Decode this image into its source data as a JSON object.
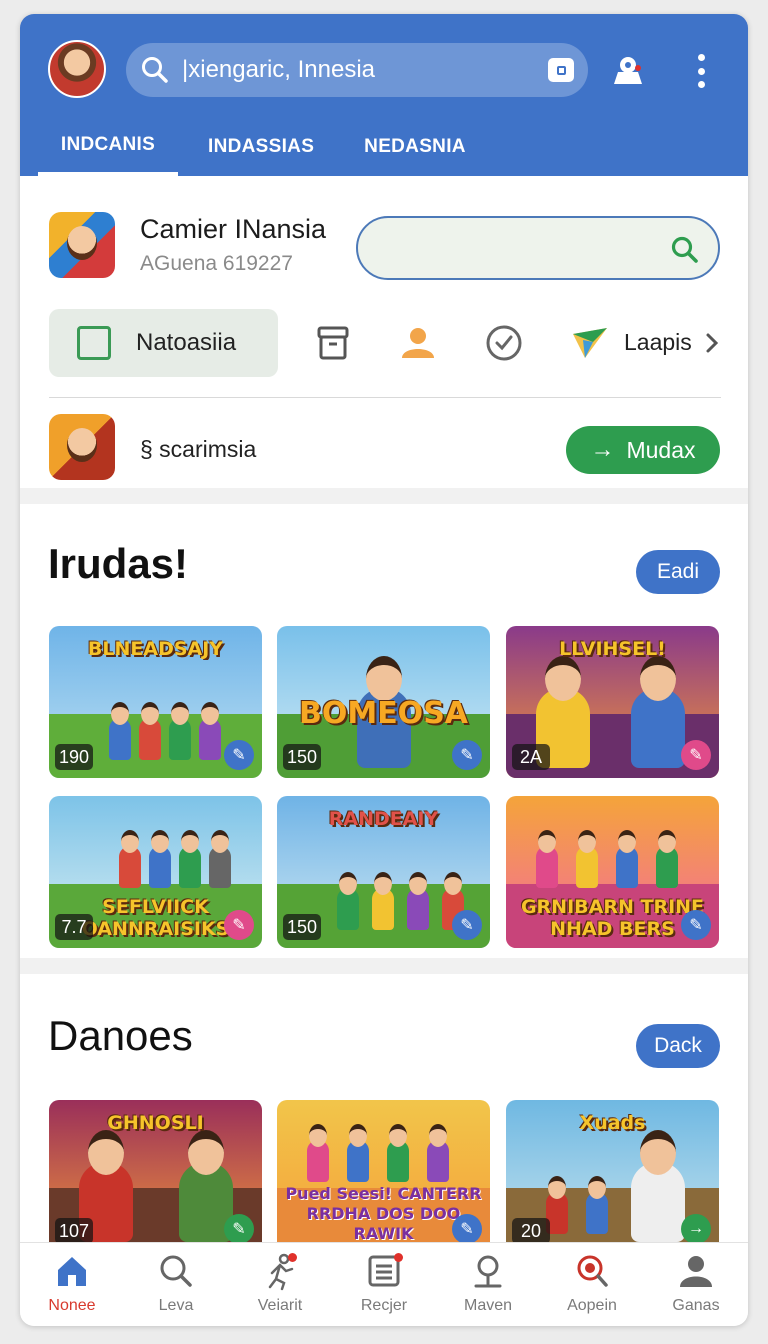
{
  "search": {
    "value": "|xiengaric, Innesia"
  },
  "tabs": [
    {
      "label": "INDCANIS",
      "active": true
    },
    {
      "label": "INDASSIAS",
      "active": false
    },
    {
      "label": "NEDASNIA",
      "active": false
    }
  ],
  "profile": {
    "name": "Camier INansia",
    "subtitle": "AGuena 619227",
    "search_placeholder": ""
  },
  "chips": {
    "selected_label": "Natoasiia",
    "icons": [
      "archive-icon",
      "person-icon",
      "check-circle-icon",
      "kite-icon"
    ],
    "trailing_label": "Laapis"
  },
  "promo": {
    "text": "§ scarimsia",
    "button_label": "Mudax"
  },
  "section1": {
    "title": "Irudas!",
    "action_label": "Eadi",
    "cards": [
      {
        "banner": "BLNEADSAJY",
        "count": "190",
        "badge_color": "#3f73c8"
      },
      {
        "banner": "BOMEOSA",
        "count": "150",
        "badge_color": "#3f73c8"
      },
      {
        "banner": "LLVIHSEL!",
        "count": "2A",
        "badge_color": "#e04a8a"
      },
      {
        "banner": "SEFLVIICK OANNRAISIKS",
        "count": "7.7",
        "badge_color": "#e04a8a"
      },
      {
        "banner": "RANDEAIY",
        "count": "150",
        "badge_color": "#3f73c8"
      },
      {
        "banner": "GRNIBARN TRINE NHAD BERS",
        "count": "",
        "badge_color": "#3f73c8"
      }
    ]
  },
  "section2": {
    "title": "Danoes",
    "action_label": "Dack",
    "cards": [
      {
        "banner": "GHNOSLI",
        "count": "107",
        "badge_color": "#2e9d4f"
      },
      {
        "banner": "Pued Seesi! CANTERR RRDHA DOS DOO RAWIK",
        "count": "",
        "badge_color": "#3f73c8"
      },
      {
        "banner": "Xuads",
        "count": "20",
        "badge_color": "#2e9d4f"
      }
    ]
  },
  "bottom_nav": [
    {
      "label": "Nonee",
      "icon": "home-icon",
      "active": true
    },
    {
      "label": "Leva",
      "icon": "search-icon",
      "active": false
    },
    {
      "label": "Veiarit",
      "icon": "runner-icon",
      "active": false
    },
    {
      "label": "Recjer",
      "icon": "list-icon",
      "active": false
    },
    {
      "label": "Maven",
      "icon": "location-pin-icon",
      "active": false
    },
    {
      "label": "Aopein",
      "icon": "zoom-icon",
      "active": false
    },
    {
      "label": "Ganas",
      "icon": "person-icon",
      "active": false
    }
  ],
  "colors": {
    "appbar": "#3f73c8",
    "accent_green": "#2e9d4f",
    "nav_active": "#d83a2e"
  }
}
